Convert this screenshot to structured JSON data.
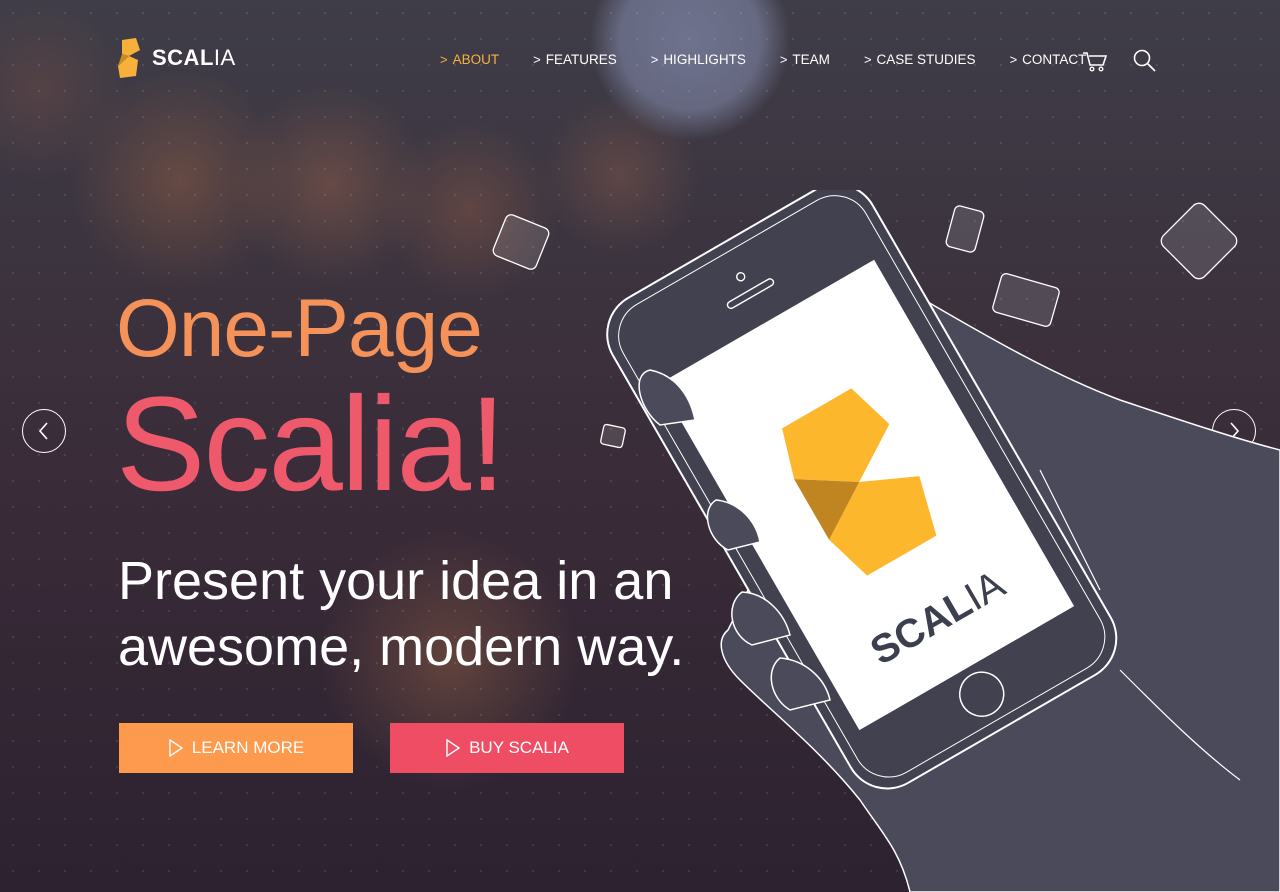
{
  "brand": {
    "name_bold": "SCAL",
    "name_light": "IA",
    "accent": "#f7b13a"
  },
  "nav": {
    "items": [
      {
        "label": "About",
        "active": true
      },
      {
        "label": "Features",
        "active": false
      },
      {
        "label": "Highlights",
        "active": false
      },
      {
        "label": "Team",
        "active": false
      },
      {
        "label": "Case Studies",
        "active": false
      },
      {
        "label": "Contact",
        "active": false
      }
    ],
    "chevron": ">",
    "icons": [
      "cart-icon",
      "search-icon"
    ]
  },
  "hero": {
    "line1": "One-Page",
    "line2": "Scalia!",
    "tagline1": "Present your idea in an",
    "tagline2": "awesome, modern way.",
    "line1_color": "#f4925a",
    "line2_color": "#ee5a6c"
  },
  "buttons": {
    "learn_more": "Learn More",
    "buy": "Buy Scalia",
    "learn_more_color": "#fd9a4d",
    "buy_color": "#ef4d64"
  },
  "slider": {
    "prev_icon": "chevron-left-icon",
    "next_icon": "chevron-right-icon"
  },
  "phone": {
    "screen_brand_bold": "SCAL",
    "screen_brand_light": "IA"
  }
}
